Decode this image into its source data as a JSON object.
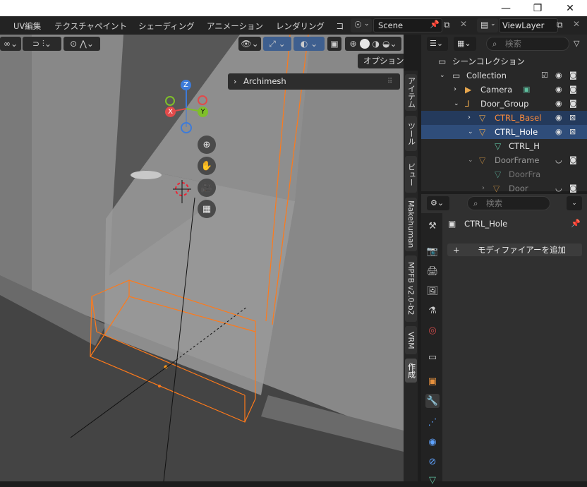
{
  "window": {
    "minimize": "—",
    "maximize": "❐",
    "close": "✕"
  },
  "menubar": {
    "items": [
      "UV編集",
      "テクスチャペイント",
      "シェーディング",
      "アニメーション",
      "レンダリング",
      "コ"
    ],
    "scene_label": "Scene",
    "viewlayer_label": "ViewLayer"
  },
  "viewport": {
    "options_label": "オプション",
    "archimesh_label": "Archimesh",
    "gizmo": {
      "x": "X",
      "y": "Y",
      "z": "Z"
    },
    "colors": {
      "x": "#e24a4a",
      "y": "#7fbf2a",
      "z": "#3d7bd9",
      "selection": "#ff7a1a"
    }
  },
  "sidebar_tabs": [
    "アイテム",
    "ツール",
    "ビュー",
    "Makehuman",
    "MPFB v2.0-b2",
    "VRM",
    "作成"
  ],
  "outliner": {
    "search_placeholder": "検索",
    "rows": [
      {
        "label": "シーンコレクション"
      },
      {
        "label": "Collection"
      },
      {
        "label": "Camera"
      },
      {
        "label": "Door_Group"
      },
      {
        "label": "CTRL_Basel"
      },
      {
        "label": "CTRL_Hole"
      },
      {
        "label": "CTRL_H"
      },
      {
        "label": "DoorFrame"
      },
      {
        "label": "DoorFra"
      },
      {
        "label": "Door"
      }
    ]
  },
  "properties": {
    "search_placeholder": "検索",
    "object_name": "CTRL_Hole",
    "add_modifier_label": "モディファイアーを追加",
    "plus": "+"
  }
}
